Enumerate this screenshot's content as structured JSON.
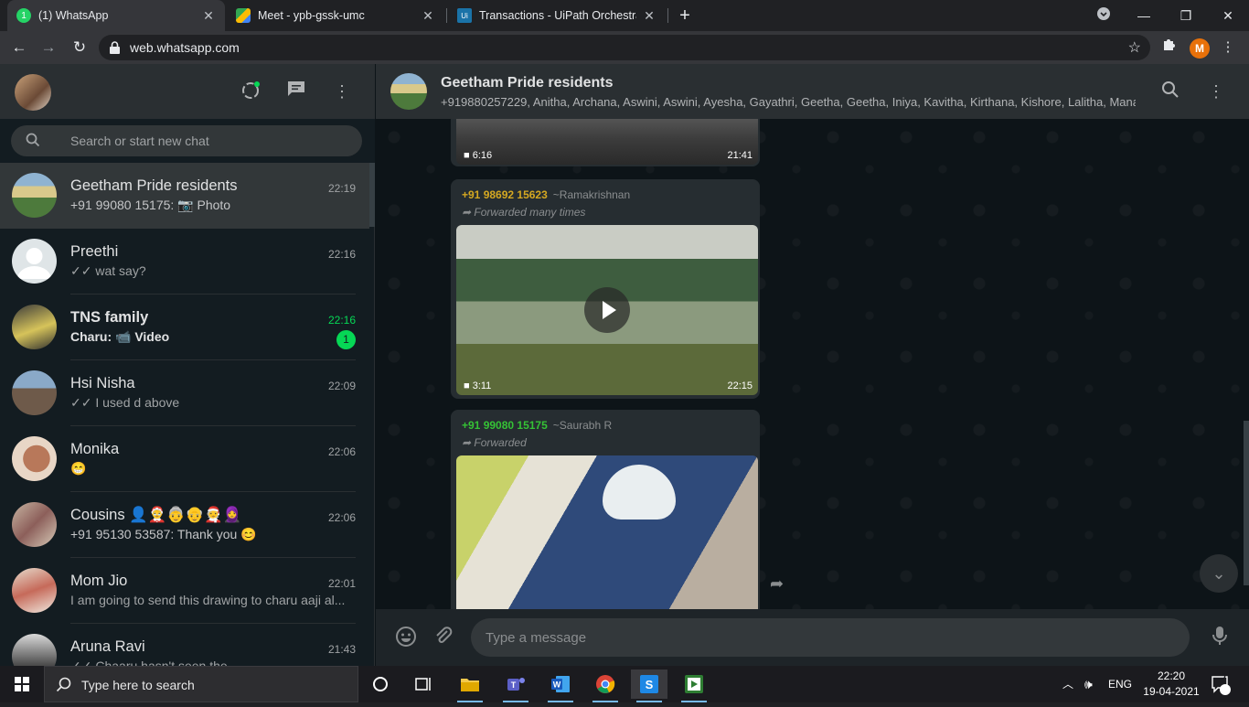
{
  "browser": {
    "tabs": [
      {
        "title": "(1) WhatsApp",
        "favicon_text": "1"
      },
      {
        "title": "Meet - ypb-gssk-umc",
        "favicon_text": ""
      },
      {
        "title": "Transactions - UiPath Orchestrato",
        "favicon_text": "Ui"
      }
    ],
    "url": "web.whatsapp.com",
    "profile_initial": "M"
  },
  "sidebar": {
    "search_placeholder": "Search or start new chat",
    "chats": [
      {
        "name": "Geetham Pride residents",
        "time": "22:19",
        "sender": "+91 99080 15175: ",
        "media_icon": "camera-icon",
        "preview": "Photo",
        "unread": "",
        "bold": false,
        "ticks": false
      },
      {
        "name": "Preethi",
        "time": "22:16",
        "sender": "",
        "media_icon": "",
        "preview": "wat say?",
        "unread": "",
        "bold": false,
        "ticks": true
      },
      {
        "name": "TNS family",
        "time": "22:16",
        "sender": "Charu: ",
        "media_icon": "video-icon",
        "preview": "Video",
        "unread": "1",
        "bold": true,
        "ticks": false
      },
      {
        "name": "Hsi Nisha",
        "time": "22:09",
        "sender": "",
        "media_icon": "",
        "preview": "I used d above",
        "unread": "",
        "bold": false,
        "ticks": true
      },
      {
        "name": "Monika",
        "time": "22:06",
        "sender": "",
        "media_icon": "",
        "preview": "😁",
        "unread": "",
        "bold": false,
        "ticks": false
      },
      {
        "name": "Cousins 👤🤶👵👴🧑‍🎄🧕",
        "time": "22:06",
        "sender": "",
        "media_icon": "",
        "preview": "+91 95130 53587: Thank you 😊",
        "unread": "",
        "bold": false,
        "ticks": false
      },
      {
        "name": "Mom Jio",
        "time": "22:01",
        "sender": "",
        "media_icon": "",
        "preview": "I am going to send this drawing to charu aaji al...",
        "unread": "",
        "bold": false,
        "ticks": false
      },
      {
        "name": "Aruna Ravi",
        "time": "21:43",
        "sender": "",
        "media_icon": "",
        "preview": "Chaaru hasn't seen the...",
        "unread": "",
        "bold": false,
        "ticks": true
      }
    ]
  },
  "conversation": {
    "title": "Geetham Pride residents",
    "participants": "+919880257229, Anitha, Archana, Aswini, Aswini, Ayesha, Gayathri, Geetha, Geetha, Iniya, Kavitha, Kirthana, Kishore, Lalitha, Manag...",
    "messages": [
      {
        "sender": "",
        "pushname": "",
        "forwarded": "",
        "duration": "6:16",
        "time": "21:41"
      },
      {
        "sender": "+91 98692 15623",
        "pushname": "~Ramakrishnan",
        "forwarded": "Forwarded many times",
        "duration": "3:11",
        "time": "22:15",
        "sender_color": "#d5a821"
      },
      {
        "sender": "+91 99080 15175",
        "pushname": "~Saurabh R",
        "forwarded": "Forwarded",
        "duration": "",
        "time": "",
        "sender_color": "#35c235"
      }
    ],
    "composer_placeholder": "Type a message"
  },
  "taskbar": {
    "search_placeholder": "Type here to search",
    "language": "ENG",
    "time": "22:20",
    "date": "19-04-2021",
    "notifications": "7"
  },
  "colors": {
    "accent_green": "#06d755",
    "panel_bg": "#131c21",
    "header_bg": "#2a2f32"
  }
}
